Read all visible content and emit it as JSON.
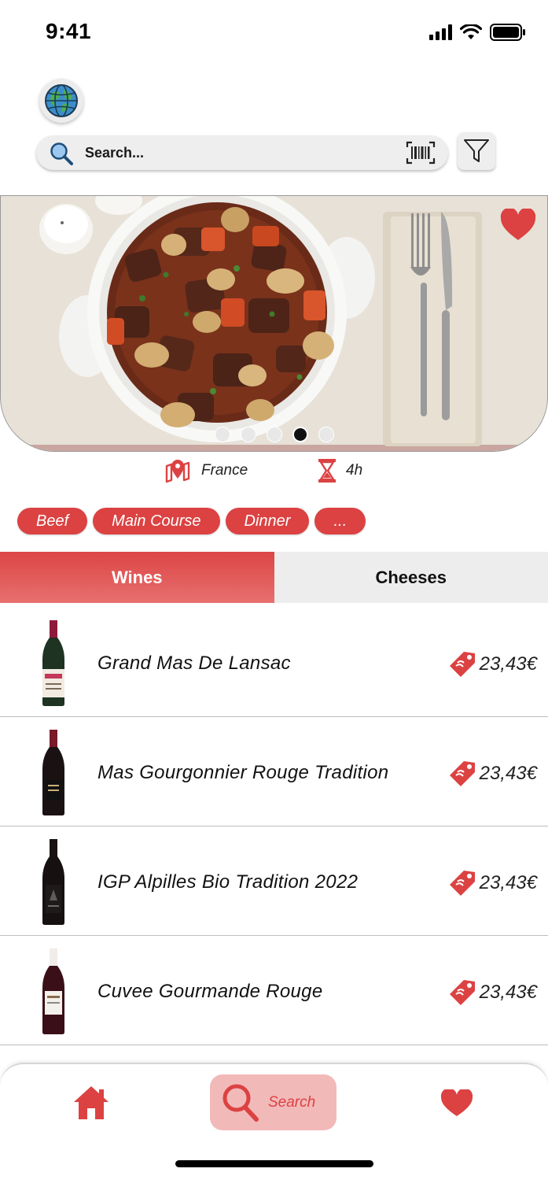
{
  "status_bar": {
    "time": "9:41"
  },
  "search": {
    "placeholder": "Search..."
  },
  "hero": {
    "slide_count": 5,
    "active_slide": 4
  },
  "recipe": {
    "origin": "France",
    "duration": "4h"
  },
  "tags": [
    "Beef",
    "Main Course",
    "Dinner",
    "..."
  ],
  "tabs": {
    "wines": "Wines",
    "cheeses": "Cheeses",
    "active": "wines"
  },
  "wines": [
    {
      "name": "Grand Mas De Lansac",
      "price": "23,43€"
    },
    {
      "name": "Mas Gourgonnier Rouge Tradition",
      "price": "23,43€"
    },
    {
      "name": "IGP Alpilles Bio Tradition 2022",
      "price": "23,43€"
    },
    {
      "name": "Cuvee Gourmande Rouge",
      "price": "23,43€"
    }
  ],
  "bottom_nav": {
    "search_label": "Search"
  },
  "colors": {
    "accent": "#dc4242",
    "accent_light": "#f2b9b9",
    "tab_inactive": "#ededed"
  }
}
